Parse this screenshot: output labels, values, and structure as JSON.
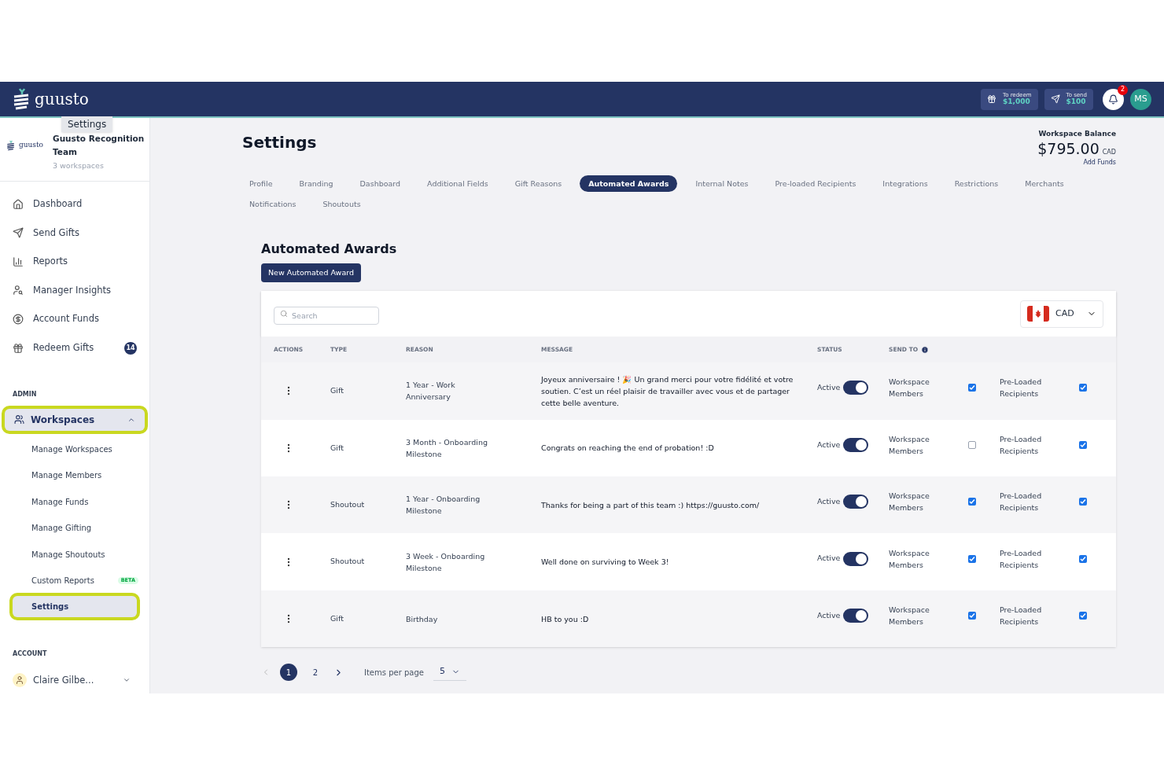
{
  "header": {
    "logo": "guusto",
    "redeem": {
      "label": "To redeem",
      "amount": "$1,000"
    },
    "send": {
      "label": "To send",
      "amount": "$100"
    },
    "notifications": "2",
    "avatar": "MS"
  },
  "tooltip": "Settings",
  "org": {
    "logo": "guusto",
    "name": "Guusto Recognition Team",
    "sub": "3 workspaces"
  },
  "nav": [
    {
      "label": "Dashboard"
    },
    {
      "label": "Send Gifts"
    },
    {
      "label": "Reports"
    },
    {
      "label": "Manager Insights"
    },
    {
      "label": "Account Funds"
    },
    {
      "label": "Redeem Gifts",
      "badge": "14"
    }
  ],
  "admin": {
    "heading": "ADMIN",
    "label": "Workspaces",
    "selected": true,
    "expanded": true,
    "children": [
      {
        "label": "Manage Workspaces",
        "selected": false
      },
      {
        "label": "Manage Members",
        "selected": false
      },
      {
        "label": "Manage Funds",
        "selected": false
      },
      {
        "label": "Manage Gifting",
        "selected": false
      },
      {
        "label": "Manage Shoutouts",
        "selected": false
      },
      {
        "label": "Custom Reports",
        "selected": false,
        "badge": "BETA"
      },
      {
        "label": "Settings",
        "selected": true
      }
    ]
  },
  "account": {
    "heading": "ACCOUNT",
    "name": "Claire Gilbe..."
  },
  "page": {
    "title": "Settings",
    "balance": {
      "label": "Workspace Balance",
      "amount": "$795.00",
      "currency": "CAD",
      "link": "Add Funds"
    }
  },
  "tabs": [
    {
      "label": "Profile",
      "selected": false
    },
    {
      "label": "Branding",
      "selected": false
    },
    {
      "label": "Dashboard",
      "selected": false
    },
    {
      "label": "Additional Fields",
      "selected": false
    },
    {
      "label": "Gift Reasons",
      "selected": false
    },
    {
      "label": "Automated Awards",
      "selected": true
    },
    {
      "label": "Internal Notes",
      "selected": false
    },
    {
      "label": "Pre-loaded Recipients",
      "selected": false
    },
    {
      "label": "Integrations",
      "selected": false
    },
    {
      "label": "Restrictions",
      "selected": false
    },
    {
      "label": "Merchants",
      "selected": false
    },
    {
      "label": "Notifications",
      "selected": false
    },
    {
      "label": "Shoutouts",
      "selected": false
    }
  ],
  "section": {
    "title": "Automated Awards",
    "button": "New Automated Award"
  },
  "search": {
    "placeholder": "Search"
  },
  "currency": "CAD",
  "table": {
    "columns": [
      "ACTIONS",
      "TYPE",
      "REASON",
      "MESSAGE",
      "STATUS",
      "SEND TO"
    ],
    "rows": [
      {
        "type": "Gift",
        "reason": "1 Year - Work Anniversary",
        "message": "Joyeux anniversaire ! 🎉 Un grand merci pour votre fidélité et votre soutien. C’est un réel plaisir de travailler avec vous et de partager cette belle aventure.",
        "status": "Active",
        "on": true,
        "members": "Workspace Members",
        "members_checked": true,
        "preloaded": "Pre-Loaded Recipients",
        "preloaded_checked": true
      },
      {
        "type": "Gift",
        "reason": "3 Month - Onboarding Milestone",
        "message": "Congrats on reaching the end of probation! :D",
        "status": "Active",
        "on": true,
        "members": "Workspace Members",
        "members_checked": false,
        "preloaded": "Pre-Loaded Recipients",
        "preloaded_checked": true
      },
      {
        "type": "Shoutout",
        "reason": "1 Year - Onboarding Milestone",
        "message": "Thanks for being a part of this team :) https://guusto.com/",
        "status": "Active",
        "on": true,
        "members": "Workspace Members",
        "members_checked": true,
        "preloaded": "Pre-Loaded Recipients",
        "preloaded_checked": true
      },
      {
        "type": "Shoutout",
        "reason": "3 Week - Onboarding Milestone",
        "message": "Well done on surviving to Week 3!",
        "status": "Active",
        "on": true,
        "members": "Workspace Members",
        "members_checked": true,
        "preloaded": "Pre-Loaded Recipients",
        "preloaded_checked": true
      },
      {
        "type": "Gift",
        "reason": "Birthday",
        "message": "HB to you :D",
        "status": "Active",
        "on": true,
        "members": "Workspace Members",
        "members_checked": true,
        "preloaded": "Pre-Loaded Recipients",
        "preloaded_checked": true
      }
    ]
  },
  "pagination": {
    "pages": [
      {
        "label": "1",
        "selected": true
      },
      {
        "label": "2",
        "selected": false
      }
    ],
    "per_page_label": "Items per page",
    "per_page": "5"
  }
}
